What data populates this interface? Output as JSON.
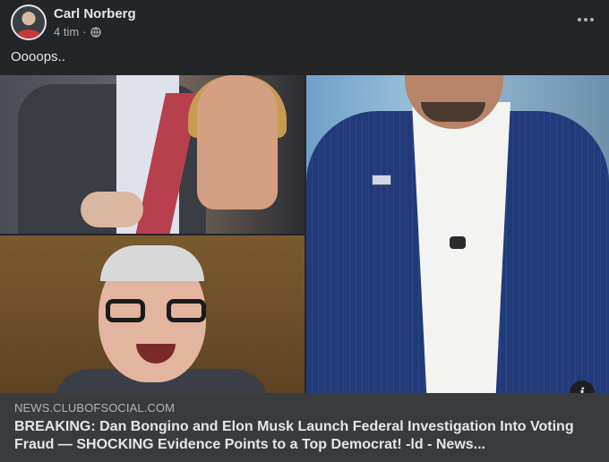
{
  "post": {
    "author": "Carl Norberg",
    "time": "4 tim",
    "separator": "·",
    "audience_icon": "globe-icon",
    "more_icon": "more-options-icon",
    "caption": "Oooops.."
  },
  "link_preview": {
    "domain": "NEWS.CLUBOFSOCIAL.COM",
    "headline": "BREAKING: Dan Bongino and Elon Musk Launch Federal Investigation Into Voting Fraud — SHOCKING Evidence Points to a Top Democrat! -ld - News...",
    "info_icon": "info-icon",
    "info_glyph": "i"
  },
  "colors": {
    "background": "#242526",
    "link_box": "#3a3b3c",
    "primary_text": "#e4e6eb",
    "secondary_text": "#b0b3b8"
  }
}
